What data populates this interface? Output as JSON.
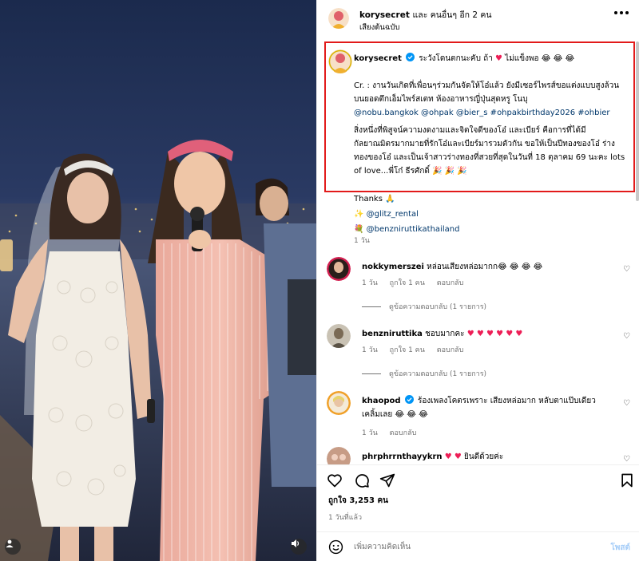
{
  "header": {
    "username": "korysecret",
    "and_others": "และ คนอื่นๆ อีก 2 คน",
    "audio": "เสียงต้นฉบับ"
  },
  "caption": {
    "username": "korysecret",
    "line1_prefix": "ระวังโดนตกนะคับ ถ้า",
    "line1_heart": "♥",
    "line1_suffix": "ไม่แข็งพอ",
    "line1_emoji": "😂 😂 😂",
    "para2": "Cr. : งานวันเกิดที่เพื่อนๆร่วมกันจัดให้โอ๋แล้ว ยังมีเซอร์ไพรส์ขอแต่งแบบสูงล้วนบนยอดตึกเอ็มไพร์สเตท ห้องอาหารญี่ปุ่นสุดหรู โนบุ",
    "tags": "@nobu.bangkok @ohpak @bier_s #ohpakbirthday2026 #ohbier",
    "para3": "สิ่งหนึ่งที่พิสูจน์ความงดงามและจิตใจดีของโอ๋ และเบียร์ คือการที่ได้มีกัลยาณมิตรมากมายที่รักโอ๋และเบียร์มารวมตัวกัน ขอให้เป็นปีทองของโอ๋ ร่างทองของโอ๋ และเป็นเจ้าสาวร่างทองที่สวยที่สุดในวันที่ 18 ตุลาคม 69 นะคะ lots of love...พี่โก๋ ธีรศักดิ์",
    "para3_emoji": "🎉 🎉 🎉",
    "thanks": "Thanks",
    "thanks_emoji": "🙏",
    "credit1_emoji": "✨",
    "credit1": "@glitz_rental",
    "credit2_emoji": "💐",
    "credit2": "@benzniruttikathailand",
    "time": "1 วัน"
  },
  "comments": [
    {
      "username": "nokkymerszei",
      "text": "หล่อนเสียงหล่อมากก😂 😂 😂 😂",
      "time": "1 วัน",
      "likes": "ถูกใจ 1 คน",
      "reply": "ตอบกลับ",
      "view_replies": "ดูข้อความตอบกลับ (1 รายการ)"
    },
    {
      "username": "benzniruttika",
      "text": "ชอบมากคะ",
      "hearts": "♥ ♥ ♥ ♥ ♥ ♥",
      "time": "1 วัน",
      "likes": "ถูกใจ 1 คน",
      "reply": "ตอบกลับ",
      "view_replies": "ดูข้อความตอบกลับ (1 รายการ)"
    },
    {
      "username": "khaopod",
      "text": "ร้องเพลงโคตรเพราะ เสียงหล่อมาก หลับตาแป๊บเดียวเคลิ้มเลย 😂 😂 😂",
      "time": "1 วัน",
      "reply": "ตอบกลับ"
    },
    {
      "username": "phrphrrnthayykrn",
      "hearts": "♥ ♥",
      "text": "ยินดีด้วยค่ะ"
    }
  ],
  "stats": {
    "likes": "ถูกใจ 3,253 คน",
    "ago": "1 วันที่แล้ว"
  },
  "composer": {
    "placeholder": "เพิ่มความคิดเห็น",
    "post": "โพสต์"
  },
  "colors": {
    "highlight_border": "#e21a1a",
    "link": "#00376b",
    "heart": "#ed1e56",
    "verified": "#0095f6"
  }
}
